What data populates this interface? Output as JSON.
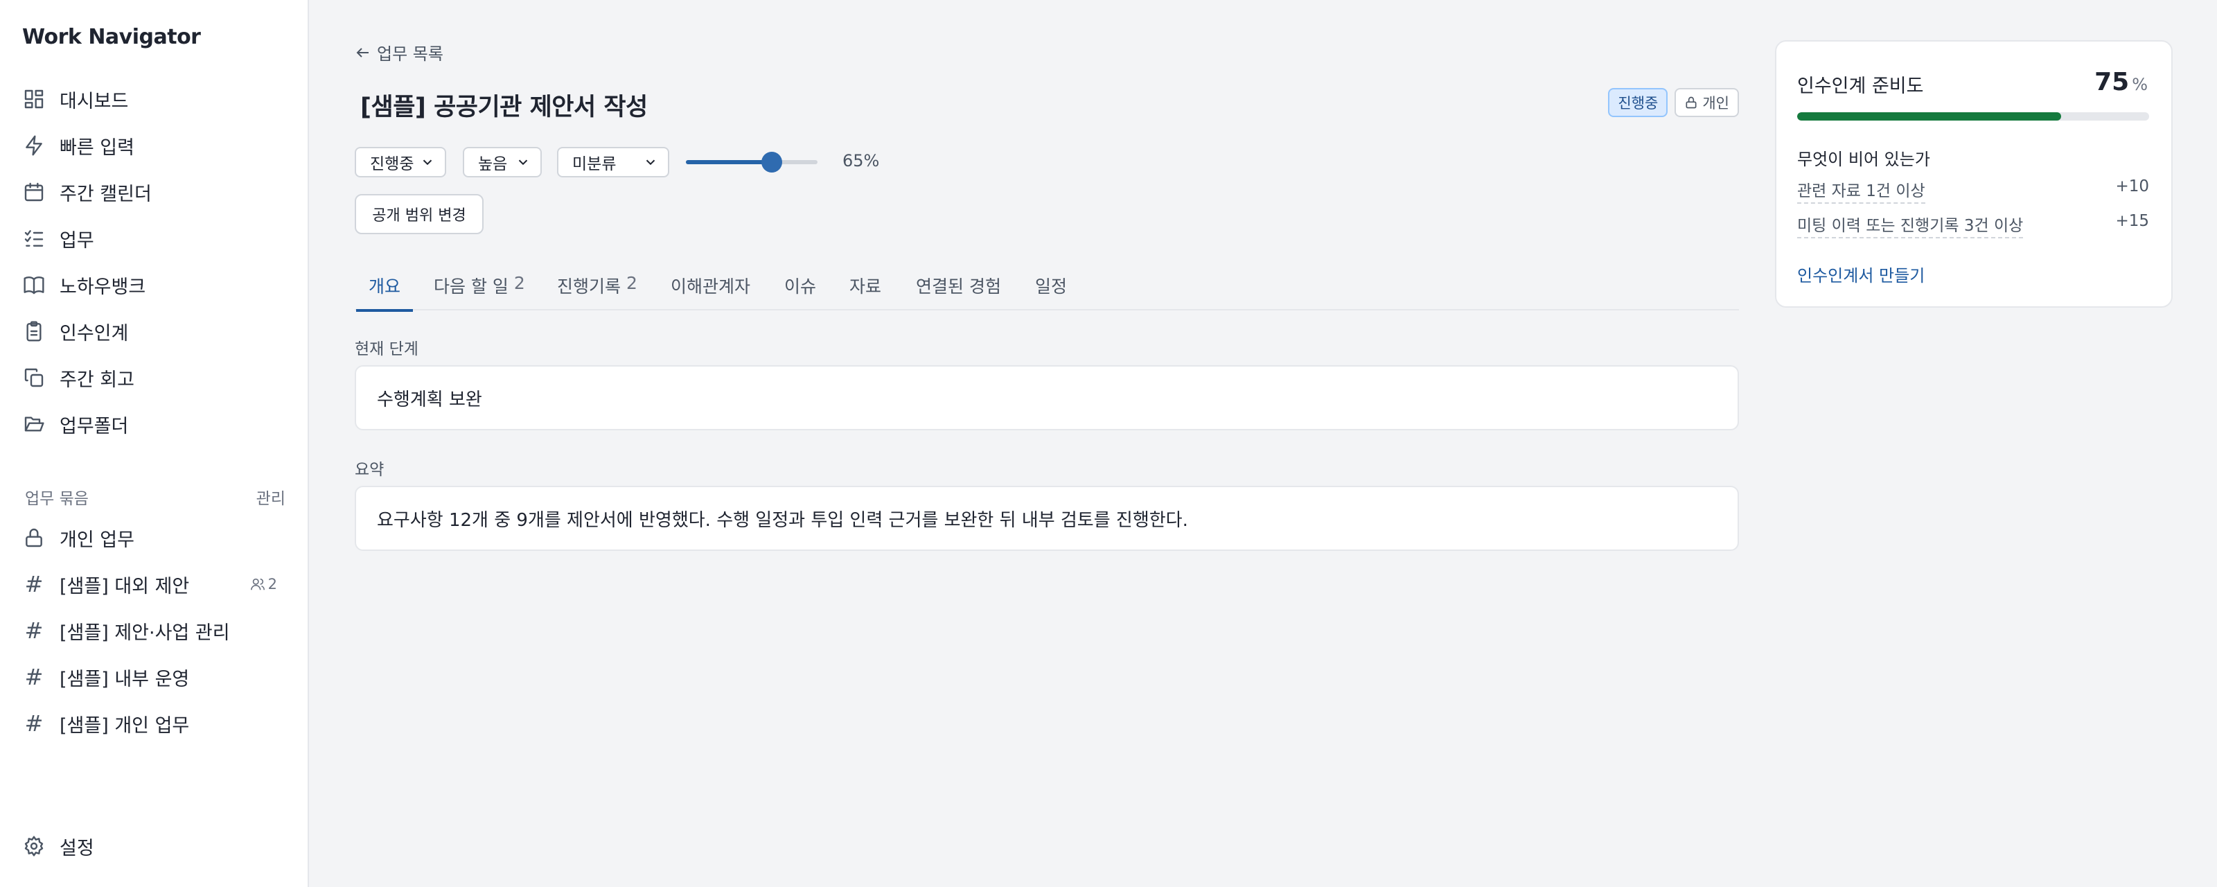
{
  "app": {
    "title": "Work Navigator"
  },
  "sidebar": {
    "items": [
      {
        "label": "대시보드",
        "icon": "dashboard-icon"
      },
      {
        "label": "빠른 입력",
        "icon": "lightning-icon"
      },
      {
        "label": "주간 캘린더",
        "icon": "calendar-icon"
      },
      {
        "label": "업무",
        "icon": "checklist-icon"
      },
      {
        "label": "노하우뱅크",
        "icon": "book-icon"
      },
      {
        "label": "인수인계",
        "icon": "clipboard-icon"
      },
      {
        "label": "주간 회고",
        "icon": "copy-icon"
      },
      {
        "label": "업무폴더",
        "icon": "folder-open-icon"
      }
    ],
    "group_header": {
      "label": "업무 묶음",
      "manage": "관리"
    },
    "groups": [
      {
        "label": "개인 업무",
        "icon": "lock-icon"
      },
      {
        "label": "[샘플] 대외 제안",
        "icon": "hash-icon",
        "members": "2"
      },
      {
        "label": "[샘플] 제안·사업 관리",
        "icon": "hash-icon"
      },
      {
        "label": "[샘플] 내부 운영",
        "icon": "hash-icon"
      },
      {
        "label": "[샘플] 개인 업무",
        "icon": "hash-icon"
      }
    ],
    "settings": {
      "label": "설정",
      "icon": "gear-icon"
    }
  },
  "main": {
    "back_link": "업무 목록",
    "title": "[샘플] 공공기관 제안서 작성",
    "badges": {
      "status": "진행중",
      "private": "개인"
    },
    "selects": {
      "status": "진행중",
      "priority": "높음",
      "category": "미분류"
    },
    "progress": {
      "value": 65,
      "label": "65%"
    },
    "scope_button": "공개 범위 변경",
    "tabs": [
      {
        "label": "개요",
        "count": ""
      },
      {
        "label": "다음 할 일",
        "count": "2"
      },
      {
        "label": "진행기록",
        "count": "2"
      },
      {
        "label": "이해관계자",
        "count": ""
      },
      {
        "label": "이슈",
        "count": ""
      },
      {
        "label": "자료",
        "count": ""
      },
      {
        "label": "연결된 경험",
        "count": ""
      },
      {
        "label": "일정",
        "count": ""
      }
    ],
    "active_tab": "개요",
    "current_stage": {
      "label": "현재 단계",
      "value": "수행계획 보완"
    },
    "summary": {
      "label": "요약",
      "value": "요구사항 12개 중 9개를 제안서에 반영했다. 수행 일정과 투입 인력 근거를 보완한 뒤 내부 검토를 진행한다."
    }
  },
  "handover_card": {
    "title": "인수인계 준비도",
    "score": "75",
    "score_unit": "%",
    "score_value": 75,
    "progress_color": "#157a3e",
    "subtitle": "무엇이 비어 있는가",
    "requirements": [
      {
        "text": "관련 자료 1건 이상",
        "points": "+10"
      },
      {
        "text": "미팅 이력 또는 진행기록 3건 이상",
        "points": "+15"
      }
    ],
    "link": "인수인계서 만들기"
  },
  "colors": {
    "accent": "#1e5aa0",
    "progress_green": "#157a3e",
    "slider": "#2f6bb0"
  }
}
